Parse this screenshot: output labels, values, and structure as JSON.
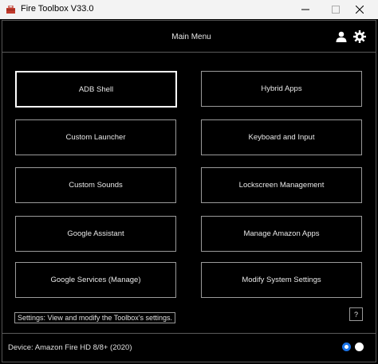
{
  "window": {
    "title": "Fire Toolbox V33.0",
    "icon": "toolbox-icon"
  },
  "header": {
    "title": "Main Menu",
    "icons": [
      "user-icon",
      "gear-icon"
    ]
  },
  "menu": {
    "left": [
      {
        "label": "ADB Shell"
      },
      {
        "label": "Custom Launcher"
      },
      {
        "label": "Custom Sounds"
      },
      {
        "label": "Google Assistant"
      },
      {
        "label": "Google Services (Manage)"
      }
    ],
    "right": [
      {
        "label": "Hybrid Apps"
      },
      {
        "label": "Keyboard and Input"
      },
      {
        "label": "Lockscreen Management"
      },
      {
        "label": "Manage Amazon Apps"
      },
      {
        "label": "Modify System Settings"
      }
    ]
  },
  "status": {
    "text": "Settings: View and modify the Toolbox's settings.",
    "help_label": "?"
  },
  "footer": {
    "device": "Device: Amazon Fire HD 8/8+ (2020)",
    "accent_color": "#1a73e8"
  }
}
